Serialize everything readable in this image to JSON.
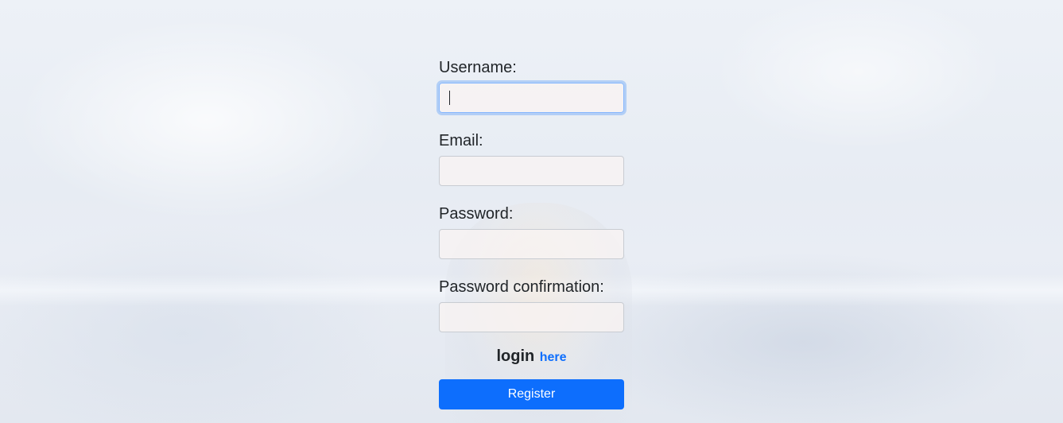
{
  "form": {
    "username_label": "Username:",
    "username_value": "",
    "email_label": "Email:",
    "email_value": "",
    "password_label": "Password:",
    "password_value": "",
    "password_confirmation_label": "Password confirmation:",
    "password_confirmation_value": "",
    "login_text": "login",
    "login_link": "here",
    "register_button": "Register"
  },
  "colors": {
    "accent": "#0d6efd",
    "text": "#212529",
    "focus_border": "#86b7fe"
  }
}
